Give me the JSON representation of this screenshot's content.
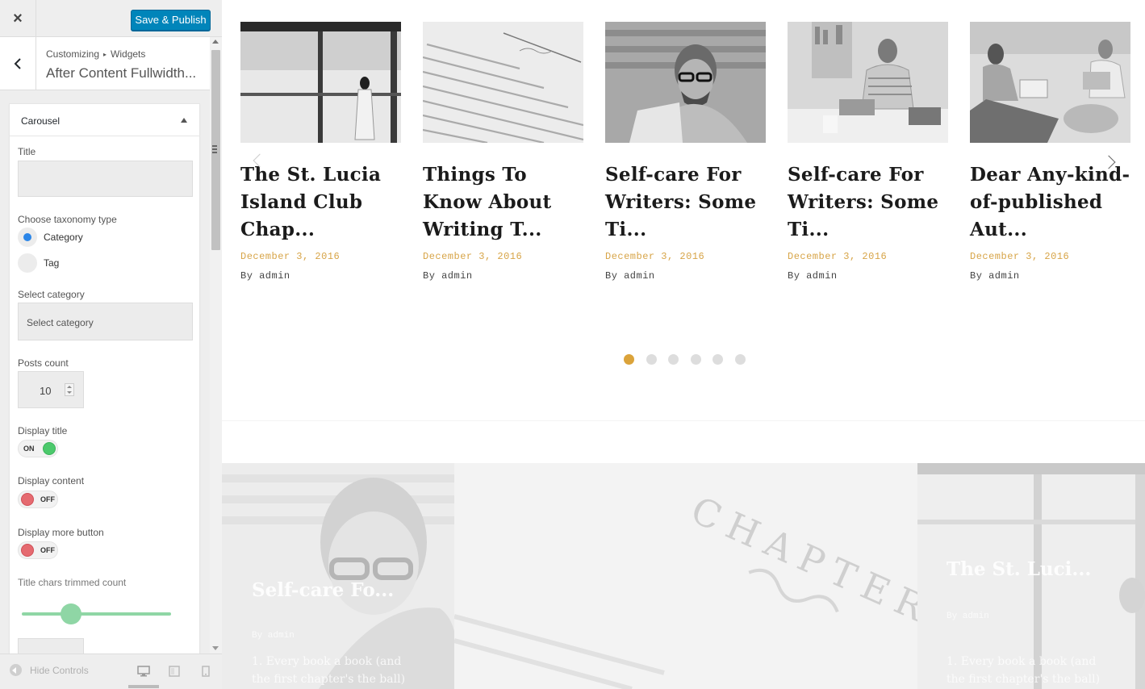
{
  "customizer": {
    "close_label": "×",
    "save_publish_label": "Save & Publish",
    "breadcrumb": [
      "Customizing",
      "Widgets"
    ],
    "section_title": "After Content Fullwidth...",
    "footer": {
      "hide_controls_label": "Hide Controls"
    }
  },
  "widget": {
    "name": "Carousel",
    "fields": {
      "title_label": "Title",
      "title_value": "",
      "taxonomy_label": "Choose taxonomy type",
      "taxonomy_options": [
        "Category",
        "Tag"
      ],
      "taxonomy_selected": "Category",
      "select_category_label": "Select category",
      "select_category_placeholder": "Select category",
      "posts_count_label": "Posts count",
      "posts_count_value": "10",
      "display_title_label": "Display title",
      "display_title_state": "ON",
      "display_content_label": "Display content",
      "display_content_state": "OFF",
      "display_more_label": "Display more button",
      "display_more_state": "OFF",
      "title_chars_label": "Title chars trimmed count"
    }
  },
  "carousel": {
    "posts": [
      {
        "title": "The St. Lucia Island Club Chap...",
        "date": "December 3, 2016",
        "author": "By admin"
      },
      {
        "title": "Things To Know About Writing T...",
        "date": "December 3, 2016",
        "author": "By admin"
      },
      {
        "title": "Self-care For Writers: Some Ti...",
        "date": "December 3, 2016",
        "author": "By admin"
      },
      {
        "title": "Self-care For Writers: Some Ti...",
        "date": "December 3, 2016",
        "author": "By admin"
      },
      {
        "title": "Dear Any-kind-of-published Aut...",
        "date": "December 3, 2016",
        "author": "By admin"
      }
    ],
    "page_count": 6,
    "active_page": 1,
    "accent_color": "#dba33a"
  },
  "featured": {
    "tiles": [
      {
        "title": "Self-care Fo...",
        "meta": "By admin",
        "excerpt": [
          "1. Every book a book (and",
          "the first chapter's the ball)"
        ]
      },
      {
        "title": "",
        "meta": "",
        "excerpt": []
      },
      {
        "title": "The St. Luci...",
        "meta": "By admin",
        "excerpt": [
          "1. Every book a book (and",
          "the first chapter's the ball)"
        ]
      }
    ],
    "watermark_text": "CHAPTER"
  },
  "icons": {
    "close": "close-icon",
    "back": "chevron-left-icon",
    "collapse": "caret-up-icon",
    "desktop": "desktop-icon",
    "tablet": "tablet-icon",
    "mobile": "mobile-icon",
    "next": "chevron-right-icon",
    "prev": "chevron-left-icon"
  },
  "colors": {
    "primary_button": "#0085ba",
    "radio_selected": "#2b86e8",
    "switch_on": "#4cc96c",
    "switch_off": "#e56a70",
    "slider": "#8fd6a5",
    "date": "#d7a447"
  }
}
